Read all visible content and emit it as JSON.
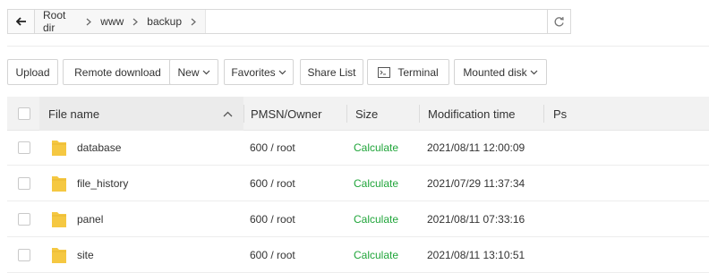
{
  "pathbar": {
    "crumbs": [
      "Root dir",
      "www",
      "backup"
    ]
  },
  "toolbar": {
    "upload": "Upload",
    "remote_download": "Remote download",
    "new": "New",
    "favorites": "Favorites",
    "share_list": "Share List",
    "terminal": "Terminal",
    "mounted_disk": "Mounted disk"
  },
  "table": {
    "headers": {
      "name": "File name",
      "perm": "PMSN/Owner",
      "size": "Size",
      "mtime": "Modification time",
      "ps": "Ps"
    },
    "rows": [
      {
        "name": "database",
        "perm": "600 / root",
        "size": "Calculate",
        "mtime": "2021/08/11 12:00:09"
      },
      {
        "name": "file_history",
        "perm": "600 / root",
        "size": "Calculate",
        "mtime": "2021/07/29 11:37:34"
      },
      {
        "name": "panel",
        "perm": "600 / root",
        "size": "Calculate",
        "mtime": "2021/08/11 07:33:16"
      },
      {
        "name": "site",
        "perm": "600 / root",
        "size": "Calculate",
        "mtime": "2021/08/11 13:10:51"
      }
    ]
  },
  "colors": {
    "folder": "#f5c842",
    "calculate": "#20a53a"
  },
  "icons": {
    "back": "arrow-left-icon",
    "separator": "chevron-right-icon",
    "refresh": "refresh-icon",
    "terminal": "terminal-icon",
    "sort": "chevron-up-icon",
    "folder": "folder-icon"
  }
}
